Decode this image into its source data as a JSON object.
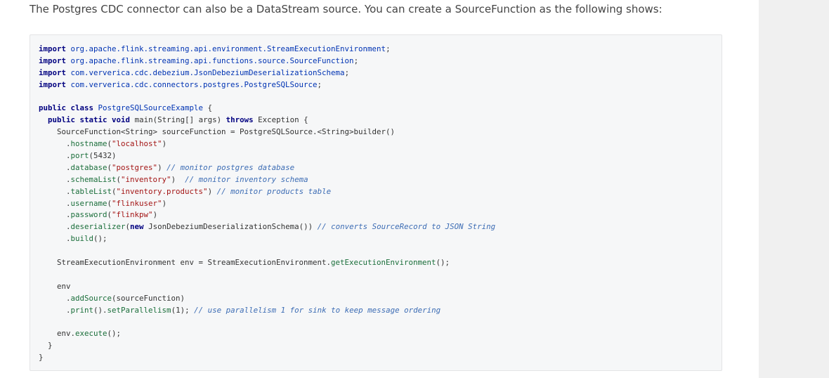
{
  "intro_text": "The Postgres CDC connector can also be a DataStream source. You can create a SourceFunction as the following shows:",
  "code_lines": [
    [
      {
        "t": "import",
        "c": "kw"
      },
      {
        "t": " "
      },
      {
        "t": "org.apache.flink.streaming.api.environment.StreamExecutionEnvironment",
        "c": "pkg"
      },
      {
        "t": ";"
      }
    ],
    [
      {
        "t": "import",
        "c": "kw"
      },
      {
        "t": " "
      },
      {
        "t": "org.apache.flink.streaming.api.functions.source.SourceFunction",
        "c": "pkg"
      },
      {
        "t": ";"
      }
    ],
    [
      {
        "t": "import",
        "c": "kw"
      },
      {
        "t": " "
      },
      {
        "t": "com.ververica.cdc.debezium.JsonDebeziumDeserializationSchema",
        "c": "pkg"
      },
      {
        "t": ";"
      }
    ],
    [
      {
        "t": "import",
        "c": "kw"
      },
      {
        "t": " "
      },
      {
        "t": "com.ververica.cdc.connectors.postgres.PostgreSQLSource",
        "c": "pkg"
      },
      {
        "t": ";"
      }
    ],
    [],
    [
      {
        "t": "public class",
        "c": "kw"
      },
      {
        "t": " "
      },
      {
        "t": "PostgreSQLSourceExample",
        "c": "cls"
      },
      {
        "t": " {"
      }
    ],
    [
      {
        "t": "  "
      },
      {
        "t": "public static",
        "c": "kw"
      },
      {
        "t": " "
      },
      {
        "t": "void",
        "c": "kw"
      },
      {
        "t": " main(String[] args) "
      },
      {
        "t": "throws",
        "c": "kw"
      },
      {
        "t": " Exception {"
      }
    ],
    [
      {
        "t": "    SourceFunction<String> sourceFunction = PostgreSQLSource.<String>builder()"
      }
    ],
    [
      {
        "t": "      ."
      },
      {
        "t": "hostname",
        "c": "mth"
      },
      {
        "t": "("
      },
      {
        "t": "\"localhost\"",
        "c": "str"
      },
      {
        "t": ")"
      }
    ],
    [
      {
        "t": "      ."
      },
      {
        "t": "port",
        "c": "mth"
      },
      {
        "t": "(5432)"
      }
    ],
    [
      {
        "t": "      ."
      },
      {
        "t": "database",
        "c": "mth"
      },
      {
        "t": "("
      },
      {
        "t": "\"postgres\"",
        "c": "str"
      },
      {
        "t": ") "
      },
      {
        "t": "// monitor postgres database",
        "c": "cmt"
      }
    ],
    [
      {
        "t": "      ."
      },
      {
        "t": "schemaList",
        "c": "mth"
      },
      {
        "t": "("
      },
      {
        "t": "\"inventory\"",
        "c": "str"
      },
      {
        "t": ")  "
      },
      {
        "t": "// monitor inventory schema",
        "c": "cmt"
      }
    ],
    [
      {
        "t": "      ."
      },
      {
        "t": "tableList",
        "c": "mth"
      },
      {
        "t": "("
      },
      {
        "t": "\"inventory.products\"",
        "c": "str"
      },
      {
        "t": ") "
      },
      {
        "t": "// monitor products table",
        "c": "cmt"
      }
    ],
    [
      {
        "t": "      ."
      },
      {
        "t": "username",
        "c": "mth"
      },
      {
        "t": "("
      },
      {
        "t": "\"flinkuser\"",
        "c": "str"
      },
      {
        "t": ")"
      }
    ],
    [
      {
        "t": "      ."
      },
      {
        "t": "password",
        "c": "mth"
      },
      {
        "t": "("
      },
      {
        "t": "\"flinkpw\"",
        "c": "str"
      },
      {
        "t": ")"
      }
    ],
    [
      {
        "t": "      ."
      },
      {
        "t": "deserializer",
        "c": "mth"
      },
      {
        "t": "("
      },
      {
        "t": "new",
        "c": "kw"
      },
      {
        "t": " JsonDebeziumDeserializationSchema()) "
      },
      {
        "t": "// converts SourceRecord to JSON String",
        "c": "cmt"
      }
    ],
    [
      {
        "t": "      ."
      },
      {
        "t": "build",
        "c": "mth"
      },
      {
        "t": "();"
      }
    ],
    [],
    [
      {
        "t": "    StreamExecutionEnvironment env = StreamExecutionEnvironment."
      },
      {
        "t": "getExecutionEnvironment",
        "c": "mth"
      },
      {
        "t": "();"
      }
    ],
    [],
    [
      {
        "t": "    env"
      }
    ],
    [
      {
        "t": "      ."
      },
      {
        "t": "addSource",
        "c": "mth"
      },
      {
        "t": "(sourceFunction)"
      }
    ],
    [
      {
        "t": "      ."
      },
      {
        "t": "print",
        "c": "mth"
      },
      {
        "t": "()."
      },
      {
        "t": "setParallelism",
        "c": "mth"
      },
      {
        "t": "(1); "
      },
      {
        "t": "// use parallelism 1 for sink to keep message ordering",
        "c": "cmt"
      }
    ],
    [],
    [
      {
        "t": "    env."
      },
      {
        "t": "execute",
        "c": "mth"
      },
      {
        "t": "();"
      }
    ],
    [
      {
        "t": "  }"
      }
    ],
    [
      {
        "t": "}"
      }
    ]
  ]
}
